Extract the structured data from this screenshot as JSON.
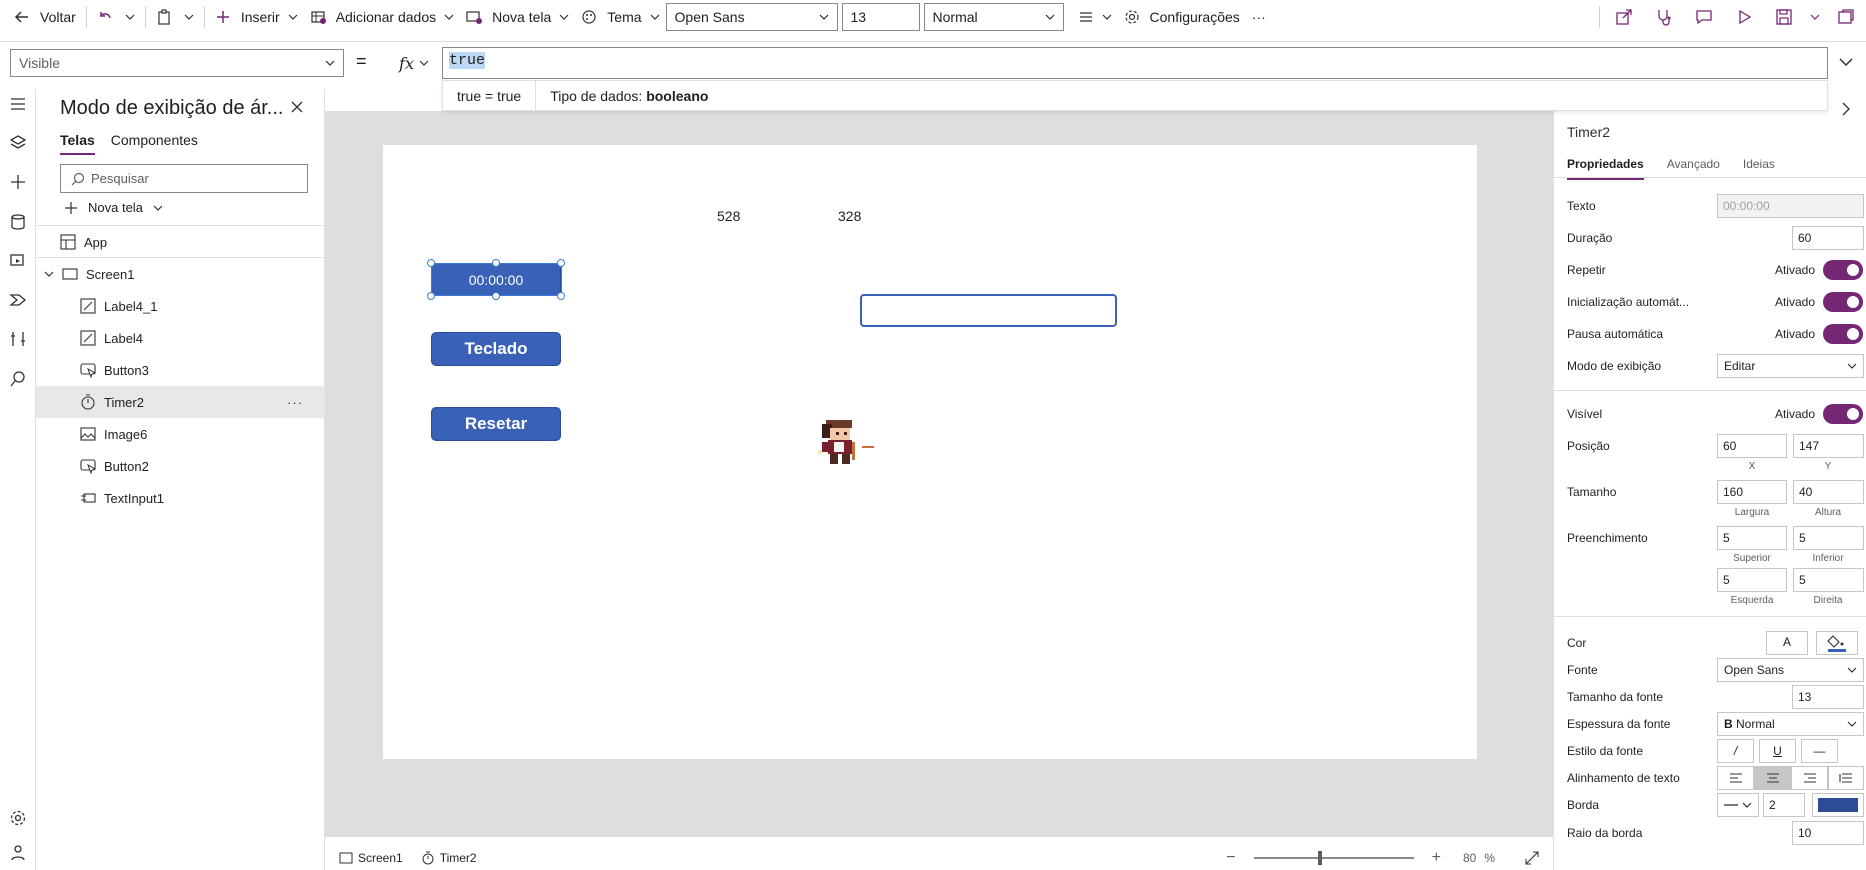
{
  "toolbar": {
    "back_label": "Voltar",
    "insert_label": "Inserir",
    "add_data_label": "Adicionar dados",
    "new_screen_label": "Nova tela",
    "theme_label": "Tema",
    "font_value": "Open Sans",
    "font_size_value": "13",
    "font_weight_value": "Normal",
    "settings_label": "Configurações",
    "more_label": "···"
  },
  "formula": {
    "property": "Visible",
    "equals": "=",
    "fx": "fx",
    "value": "true",
    "hint_expression": "true  =  true",
    "hint_type_prefix": "Tipo de dados:",
    "hint_type_value": "booleano"
  },
  "tree": {
    "title": "Modo de exibição de ár...",
    "tabs": [
      "Telas",
      "Componentes"
    ],
    "search_placeholder": "Pesquisar",
    "new_screen_label": "Nova tela",
    "app_label": "App",
    "screen_label": "Screen1",
    "items": [
      {
        "label": "Label4_1",
        "icon": "label-icon"
      },
      {
        "label": "Label4",
        "icon": "label-icon"
      },
      {
        "label": "Button3",
        "icon": "button-icon"
      },
      {
        "label": "Timer2",
        "icon": "timer-icon"
      },
      {
        "label": "Image6",
        "icon": "image-icon"
      },
      {
        "label": "Button2",
        "icon": "button-icon"
      },
      {
        "label": "TextInput1",
        "icon": "text-input-icon"
      }
    ],
    "more_label": "···"
  },
  "canvas": {
    "label_a": "528",
    "label_b": "328",
    "timer_text": "00:00:00",
    "button_keyboard": "Teclado",
    "button_reset": "Resetar"
  },
  "status": {
    "screen_crumb": "Screen1",
    "control_crumb": "Timer2",
    "zoom_value": "80",
    "zoom_unit": "%"
  },
  "props": {
    "control_name": "Timer2",
    "tabs": [
      "Propriedades",
      "Avançado",
      "Ideias"
    ],
    "text_label": "Texto",
    "text_value": "00:00:00",
    "duration_label": "Duração",
    "duration_value": "60",
    "repeat_label": "Repetir",
    "autostart_label": "Inicialização automát...",
    "autopause_label": "Pausa automática",
    "on_label": "Ativado",
    "display_mode_label": "Modo de exibição",
    "display_mode_value": "Editar",
    "visible_label": "Visível",
    "position_label": "Posição",
    "position_x": "60",
    "position_y": "147",
    "x_sub": "X",
    "y_sub": "Y",
    "size_label": "Tamanho",
    "width_value": "160",
    "height_value": "40",
    "width_sub": "Largura",
    "height_sub": "Altura",
    "padding_label": "Preenchimento",
    "pad_top": "5",
    "pad_bottom": "5",
    "pad_left": "5",
    "pad_right": "5",
    "pad_top_sub": "Superior",
    "pad_bottom_sub": "Inferior",
    "pad_left_sub": "Esquerda",
    "pad_right_sub": "Direita",
    "color_label": "Cor",
    "color_text_glyph": "A",
    "font_label": "Fonte",
    "font_value": "Open Sans",
    "font_size_label": "Tamanho da fonte",
    "font_size_value": "13",
    "font_weight_label": "Espessura da fonte",
    "font_weight_glyph": "B",
    "font_weight_value": "Normal",
    "font_style_label": "Estilo da fonte",
    "italic_glyph": "/",
    "underline_glyph": "U",
    "strike_glyph": "—",
    "align_label": "Alinhamento de texto",
    "border_label": "Borda",
    "border_width": "2",
    "border_color": "#2c4d96",
    "radius_label": "Raio da borda",
    "radius_value": "10"
  },
  "colors": {
    "accent": "#742774",
    "button_fill": "#3a61b8"
  }
}
